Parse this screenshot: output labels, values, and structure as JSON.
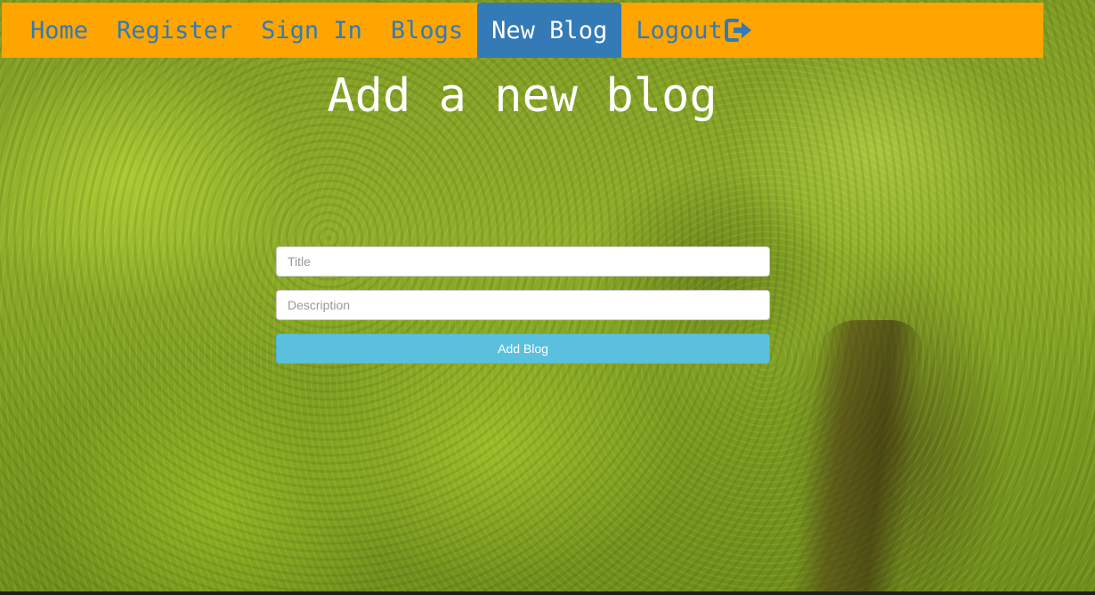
{
  "nav": {
    "items": [
      {
        "label": "Home"
      },
      {
        "label": "Register"
      },
      {
        "label": "Sign In"
      },
      {
        "label": "Blogs"
      },
      {
        "label": "New Blog",
        "active": true
      },
      {
        "label": "Logout",
        "icon": "logout-icon"
      }
    ],
    "background_color": "#ffa500",
    "link_color": "#337ab7",
    "active_background": "#337ab7"
  },
  "page": {
    "title": "Add a new blog"
  },
  "form": {
    "title_placeholder": "Title",
    "title_value": "",
    "description_placeholder": "Description",
    "description_value": "",
    "submit_label": "Add Blog",
    "submit_color": "#5bc0de"
  }
}
